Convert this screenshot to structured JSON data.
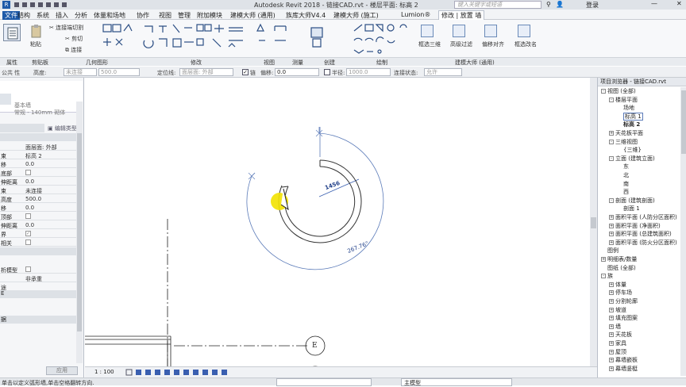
{
  "titlebar": {
    "title": "Autodesk Revit 2018 -   链接CAD.rvt - 楼层平面: 标高 2",
    "search_placeholder": "键入关键字或短语",
    "login": "登录"
  },
  "menu": [
    {
      "label": "文件"
    },
    {
      "label": "结构"
    },
    {
      "label": "系统"
    },
    {
      "label": "插入"
    },
    {
      "label": "分析"
    },
    {
      "label": "体量和场地"
    },
    {
      "label": "协作"
    },
    {
      "label": "视图"
    },
    {
      "label": "管理"
    },
    {
      "label": "附加模块"
    },
    {
      "label": "建模大师 (通用)"
    },
    {
      "label": "族库大师V4.4"
    },
    {
      "label": "建模大师 (施工)"
    },
    {
      "label": "Lumion®"
    },
    {
      "label": "修改 | 放置 墙"
    }
  ],
  "ribbon": {
    "clipboard": {
      "paste": "粘贴",
      "cut": "剪切",
      "join": "连接",
      "cope": "连接端切割"
    },
    "panels": [
      "属性",
      "剪贴板",
      "几何图形",
      "修改",
      "视图",
      "测量",
      "创建",
      "绘制",
      "建模大师 (通用)"
    ],
    "modeling_tools": [
      "框选三维",
      "高级过滤",
      "偏移对齐",
      "框选改名"
    ]
  },
  "options": {
    "level_label": "公共 性",
    "height_label": "高度:",
    "height_value": "未连接",
    "height_num": "500.0",
    "location_label": "定位线:",
    "location_value": "面层面: 外部",
    "chain_label": "链",
    "offset_label": "偏移:",
    "offset_value": "0.0",
    "radius_label": "半径:",
    "radius_value": "1000.0",
    "join_label": "连接状态:",
    "join_value": "允许"
  },
  "properties": {
    "type_name": "基本墙",
    "type_sub": "常规 - 140mm 砌体",
    "edit_type": "编辑类型",
    "rows": [
      {
        "k": "",
        "v": "面层面: 外部"
      },
      {
        "k": "束",
        "v": "标高 2"
      },
      {
        "k": "移",
        "v": "0.0"
      },
      {
        "k": "底部",
        "v": ""
      },
      {
        "k": "伸距离",
        "v": "0.0"
      },
      {
        "k": "束",
        "v": "未连接"
      },
      {
        "k": "高度",
        "v": "500.0"
      },
      {
        "k": "移",
        "v": "0.0"
      },
      {
        "k": "顶部",
        "v": ""
      },
      {
        "k": "伸距离",
        "v": "0.0"
      },
      {
        "k": "界",
        "v": ""
      },
      {
        "k": "相关",
        "v": ""
      },
      {
        "k": "",
        "v": ""
      },
      {
        "k": "析模型",
        "v": ""
      },
      {
        "k": "",
        "v": "非承重"
      },
      {
        "k": "途",
        "v": ""
      }
    ],
    "section1": "E",
    "section2": "据",
    "apply": "应用"
  },
  "canvas": {
    "dim_linear": "1456",
    "dim_arc": "267.76°",
    "grid_label": "E"
  },
  "status": {
    "scale": "1 : 100",
    "model": "主模型",
    "hint": "单击以定义弧形墙,单击空格翻转方向."
  },
  "browser": {
    "title": "项目浏览器 - 链接CAD.rvt",
    "nodes": [
      {
        "label": "视图 (全部)",
        "level": 0,
        "tog": "-"
      },
      {
        "label": "楼层平面",
        "level": 1,
        "tog": "-"
      },
      {
        "label": "场地",
        "level": 2,
        "tog": ""
      },
      {
        "label": "标高 1",
        "level": 2,
        "tog": ""
      },
      {
        "label": "标高 2",
        "level": 2,
        "tog": ""
      },
      {
        "label": "天花板平面",
        "level": 1,
        "tog": "+"
      },
      {
        "label": "三维视图",
        "level": 1,
        "tog": "-"
      },
      {
        "label": "{三维}",
        "level": 2,
        "tog": ""
      },
      {
        "label": "立面 (建筑立面)",
        "level": 1,
        "tog": "-"
      },
      {
        "label": "东",
        "level": 2,
        "tog": ""
      },
      {
        "label": "北",
        "level": 2,
        "tog": ""
      },
      {
        "label": "南",
        "level": 2,
        "tog": ""
      },
      {
        "label": "西",
        "level": 2,
        "tog": ""
      },
      {
        "label": "剖面 (建筑剖面)",
        "level": 1,
        "tog": "-"
      },
      {
        "label": "剖面 1",
        "level": 2,
        "tog": ""
      },
      {
        "label": "面积平面 (人防分区面积)",
        "level": 1,
        "tog": "+"
      },
      {
        "label": "面积平面 (净面积)",
        "level": 1,
        "tog": "+"
      },
      {
        "label": "面积平面 (总建筑面积)",
        "level": 1,
        "tog": "+"
      },
      {
        "label": "面积平面 (防火分区面积)",
        "level": 1,
        "tog": "+"
      },
      {
        "label": "图例",
        "level": 0,
        "tog": ""
      },
      {
        "label": "明细表/数量",
        "level": 0,
        "tog": "+"
      },
      {
        "label": "图纸 (全部)",
        "level": 0,
        "tog": ""
      },
      {
        "label": "族",
        "level": 0,
        "tog": "-"
      },
      {
        "label": "体量",
        "level": 1,
        "tog": "+"
      },
      {
        "label": "停车场",
        "level": 1,
        "tog": "+"
      },
      {
        "label": "分割轮廓",
        "level": 1,
        "tog": "+"
      },
      {
        "label": "坡道",
        "level": 1,
        "tog": "+"
      },
      {
        "label": "填充图案",
        "level": 1,
        "tog": "+"
      },
      {
        "label": "墙",
        "level": 1,
        "tog": "+"
      },
      {
        "label": "天花板",
        "level": 1,
        "tog": "+"
      },
      {
        "label": "家具",
        "level": 1,
        "tog": "+"
      },
      {
        "label": "屋顶",
        "level": 1,
        "tog": "+"
      },
      {
        "label": "幕墙嵌板",
        "level": 1,
        "tog": "+"
      },
      {
        "label": "幕墙竖梃",
        "level": 1,
        "tog": "+"
      }
    ]
  },
  "colors": {
    "accent": "#1e5aa8",
    "dim": "#2a5fb0",
    "cursor": "#f2e200"
  }
}
